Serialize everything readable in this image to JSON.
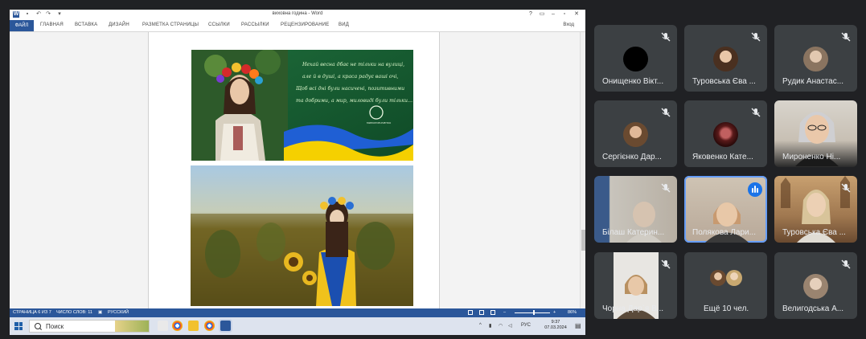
{
  "word": {
    "title": "виховна година - Word",
    "tabs": [
      "ФАЙЛ",
      "ГЛАВНАЯ",
      "ВСТАВКА",
      "ДИЗАЙН",
      "РАЗМЕТКА СТРАНИЦЫ",
      "ССЫЛКИ",
      "РАССЫЛКИ",
      "РЕЦЕНЗИРОВАНИЕ",
      "ВИД"
    ],
    "user": "Вход",
    "page_text": {
      "poem_lines": [
        "Нехай весна дбає не тільки на вулиці,",
        "але й в душі, а краса радує ваші очі,",
        "Щоб всі дні були насичені, позитивними",
        "та добрими, а мир, миловиді були тільки…"
      ],
      "logo_caption": "МИРОЛЮБЧІЧЕНКО"
    },
    "status": {
      "page": "СТРАНИЦА 6 ИЗ 7",
      "words": "ЧИСЛО СЛОВ: 11",
      "language": "РУССКИЙ",
      "zoom": "86%"
    }
  },
  "taskbar": {
    "search_placeholder": "Поиск",
    "tray_lang": "РУС",
    "time": "9:37",
    "date": "07.03.2024"
  },
  "meeting": {
    "participants": [
      {
        "name": "Онищенко Вікт...",
        "mic": "muted",
        "avatar": "black"
      },
      {
        "name": "Туровська Єва ...",
        "mic": "muted",
        "avatar": "photo"
      },
      {
        "name": "Рудик Анастас...",
        "mic": "muted",
        "avatar": "photo"
      },
      {
        "name": "Сергієнко Дар...",
        "mic": "muted",
        "avatar": "photo"
      },
      {
        "name": "Яковенко Кате...",
        "mic": "muted",
        "avatar": "photo"
      },
      {
        "name": "Мироненко Ні...",
        "mic": "on",
        "avatar": "video"
      },
      {
        "name": "Білаш Катерин...",
        "mic": "muted",
        "avatar": "video"
      },
      {
        "name": "Полякова Лари...",
        "mic": "speaking",
        "avatar": "video"
      },
      {
        "name": "Туровська Єва ...",
        "mic": "muted",
        "avatar": "video"
      },
      {
        "name": "Чорна Дар`я В...",
        "mic": "muted",
        "avatar": "video"
      },
      {
        "name": "Ещё 10 чел.",
        "mic": "none",
        "avatar": "group"
      },
      {
        "name": "Велигодська А...",
        "mic": "muted",
        "avatar": "photo"
      }
    ]
  },
  "colors": {
    "word_blue": "#2b579a",
    "meet_bg": "#202124",
    "tile_bg": "#3c4043",
    "speaking": "#669df6"
  }
}
